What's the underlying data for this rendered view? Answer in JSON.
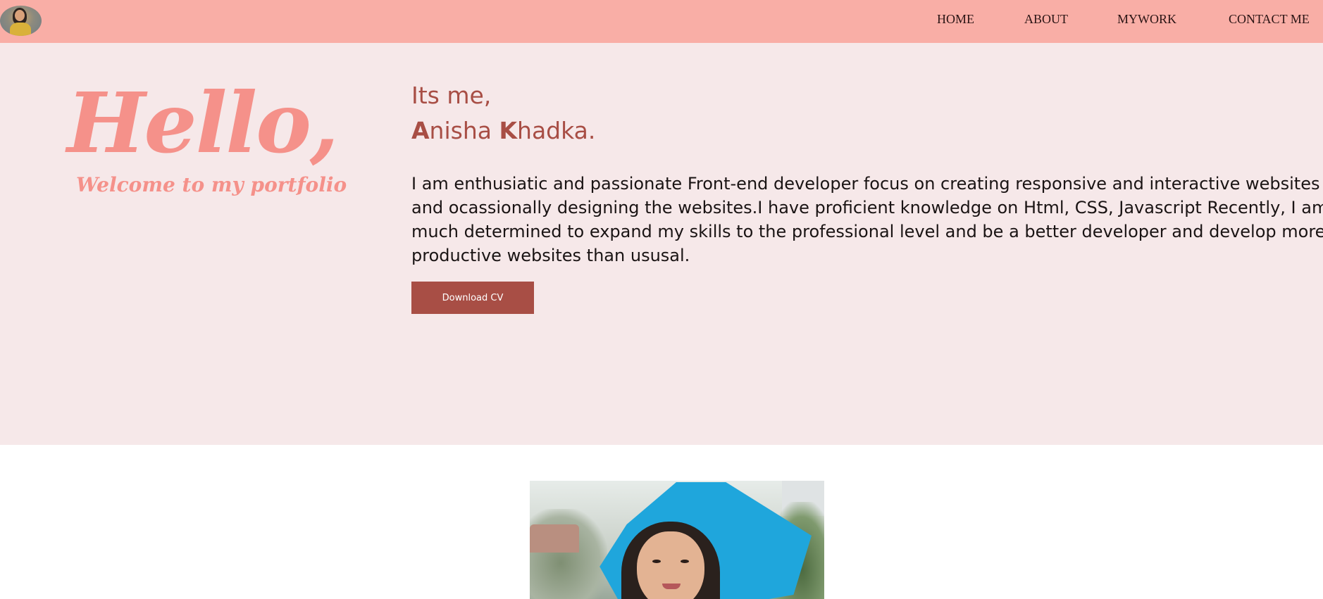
{
  "nav": {
    "logo_alt": "profile avatar",
    "items": [
      {
        "label": "HOME"
      },
      {
        "label": "ABOUT"
      },
      {
        "label": "MYWORK"
      },
      {
        "label": "CONTACT ME"
      }
    ]
  },
  "hero": {
    "hello": "Hello,",
    "welcome": "Welcome to my portfolio",
    "intro": "Its me,",
    "name": {
      "first_initial": "A",
      "first_rest": "nisha ",
      "last_initial": "K",
      "last_rest": "hadka."
    },
    "bio_lines": [
      "I am enthusiatic and passionate Front-end developer focus on creating responsive and interactive websites",
      "and ocassionally designing the websites.I have proficient knowledge on Html, CSS, Javascript Recently, I am very",
      "much determined to expand my skills to the professional level and be a better developer and develop more",
      "productive websites than ususal."
    ],
    "download_button": "Download CV"
  },
  "profile_photo": {
    "alt": "portrait photo"
  },
  "colors": {
    "navbar_bg": "#f9aea6",
    "hero_bg": "#f6e8e9",
    "accent": "#a84e45",
    "hello_pink": "#f5918a",
    "text_dark": "#1a1414"
  }
}
